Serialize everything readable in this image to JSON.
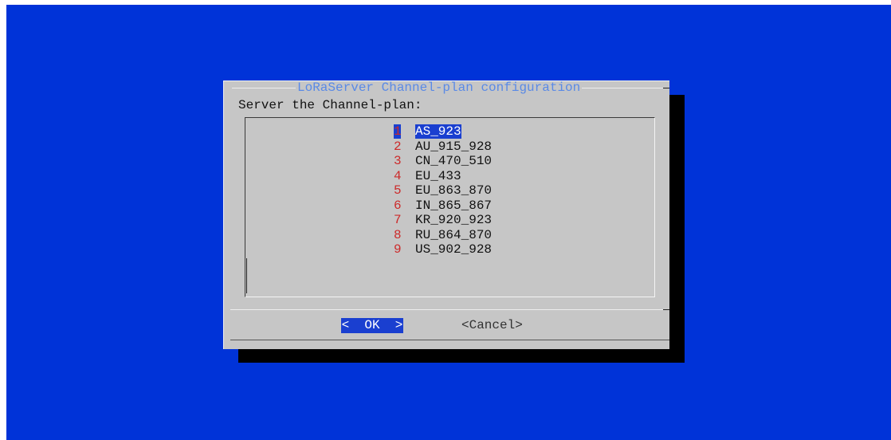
{
  "dialog": {
    "title": "LoRaServer Channel-plan configuration",
    "prompt": "Server the Channel-plan:"
  },
  "menu": {
    "items": [
      {
        "num": "1",
        "label": "AS_923",
        "selected": true
      },
      {
        "num": "2",
        "label": "AU_915_928"
      },
      {
        "num": "3",
        "label": "CN_470_510"
      },
      {
        "num": "4",
        "label": "EU_433"
      },
      {
        "num": "5",
        "label": "EU_863_870"
      },
      {
        "num": "6",
        "label": "IN_865_867"
      },
      {
        "num": "7",
        "label": "KR_920_923"
      },
      {
        "num": "8",
        "label": "RU_864_870"
      },
      {
        "num": "9",
        "label": "US_902_928"
      }
    ]
  },
  "buttons": {
    "ok": "<  OK  >",
    "cancel": "<Cancel>"
  },
  "colors": {
    "background": "#0033d8",
    "dialog": "#c6c6c6",
    "title": "#5a8ae6",
    "number": "#cc2a2a",
    "highlight": "#1a3fd0"
  }
}
